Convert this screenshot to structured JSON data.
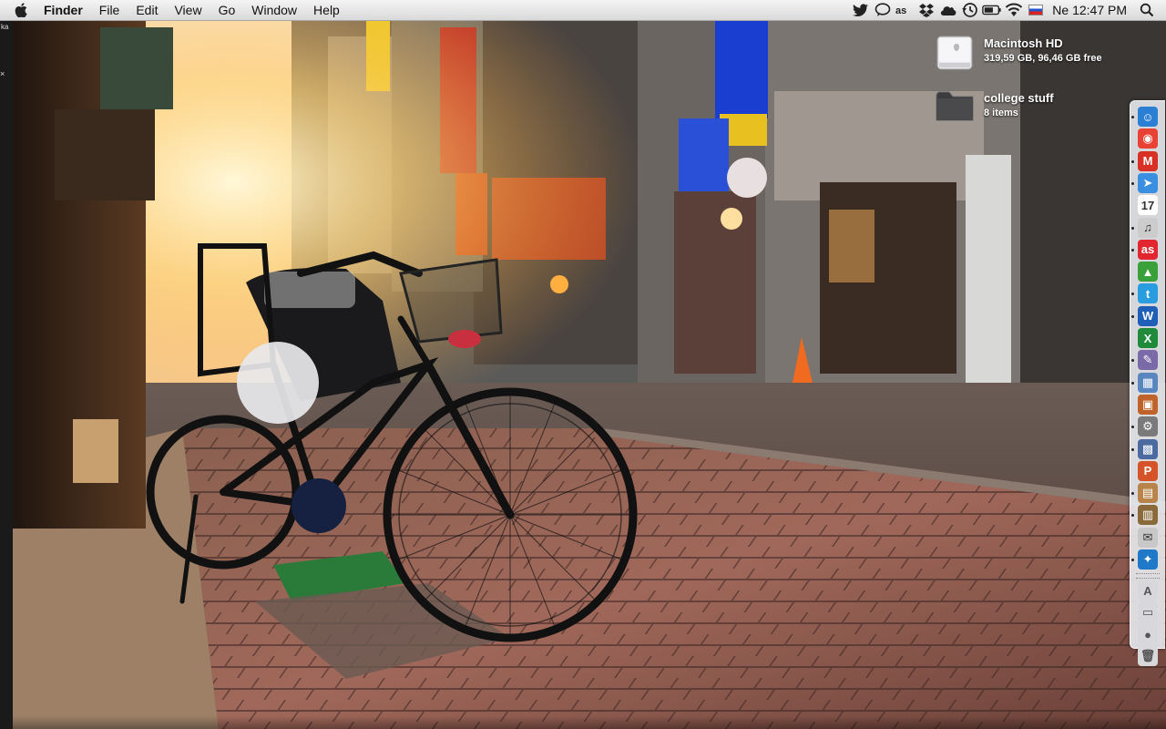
{
  "menubar": {
    "app_name": "Finder",
    "menus": [
      "File",
      "Edit",
      "View",
      "Go",
      "Window",
      "Help"
    ],
    "status_icons": [
      "twitter-icon",
      "chat-icon",
      "lastfm-icon",
      "dropbox-icon",
      "icloud-icon",
      "time-machine-icon",
      "battery-icon",
      "wifi-icon",
      "input-source-flag-icon"
    ],
    "clock": "Ne 12:47 PM",
    "search_icon": "spotlight-icon"
  },
  "desktop": {
    "items": [
      {
        "title": "Macintosh HD",
        "subtitle": "319,59 GB, 96,46 GB free",
        "icon": "hard-drive-icon"
      },
      {
        "title": "college stuff",
        "subtitle": "8 items",
        "icon": "folder-icon"
      }
    ]
  },
  "left_edge": {
    "label": "ka"
  },
  "dock": {
    "apps": [
      {
        "name": "finder",
        "color": "#2a7fd4",
        "glyph": "☺"
      },
      {
        "name": "chrome",
        "color": "#e94235",
        "glyph": "◉"
      },
      {
        "name": "gmail",
        "color": "#d93025",
        "glyph": "M"
      },
      {
        "name": "mail",
        "color": "#3b8fe0",
        "glyph": "➤"
      },
      {
        "name": "calendar",
        "color": "#ffffff",
        "glyph": "17"
      },
      {
        "name": "itunes",
        "color": "#cccccc",
        "glyph": "♫"
      },
      {
        "name": "lastfm",
        "color": "#e2262f",
        "glyph": "as"
      },
      {
        "name": "android",
        "color": "#3aa03a",
        "glyph": "▲"
      },
      {
        "name": "twitter",
        "color": "#2a9de0",
        "glyph": "t"
      },
      {
        "name": "word",
        "color": "#1f5fb8",
        "glyph": "W"
      },
      {
        "name": "excel",
        "color": "#1e8a3a",
        "glyph": "X"
      },
      {
        "name": "pencil",
        "color": "#7a6aa8",
        "glyph": "✎"
      },
      {
        "name": "preview",
        "color": "#5a86c0",
        "glyph": "▦"
      },
      {
        "name": "photo-app",
        "color": "#c0632a",
        "glyph": "▣"
      },
      {
        "name": "system-prefs",
        "color": "#7a7a7a",
        "glyph": "⚙"
      },
      {
        "name": "photos",
        "color": "#4a6aa0",
        "glyph": "▩"
      },
      {
        "name": "powerpoint",
        "color": "#d6532a",
        "glyph": "P"
      },
      {
        "name": "notes",
        "color": "#b8844a",
        "glyph": "▤"
      },
      {
        "name": "archive",
        "color": "#8a6a3a",
        "glyph": "▥"
      },
      {
        "name": "script-editor",
        "color": "#c8c8c8",
        "glyph": "✉"
      },
      {
        "name": "safari",
        "color": "#1f78c8",
        "glyph": "✦"
      }
    ],
    "stacks": [
      {
        "name": "applications",
        "glyph": "A"
      },
      {
        "name": "documents",
        "glyph": "▭"
      },
      {
        "name": "downloads",
        "glyph": "●"
      },
      {
        "name": "trash",
        "glyph": "🗑"
      }
    ]
  }
}
